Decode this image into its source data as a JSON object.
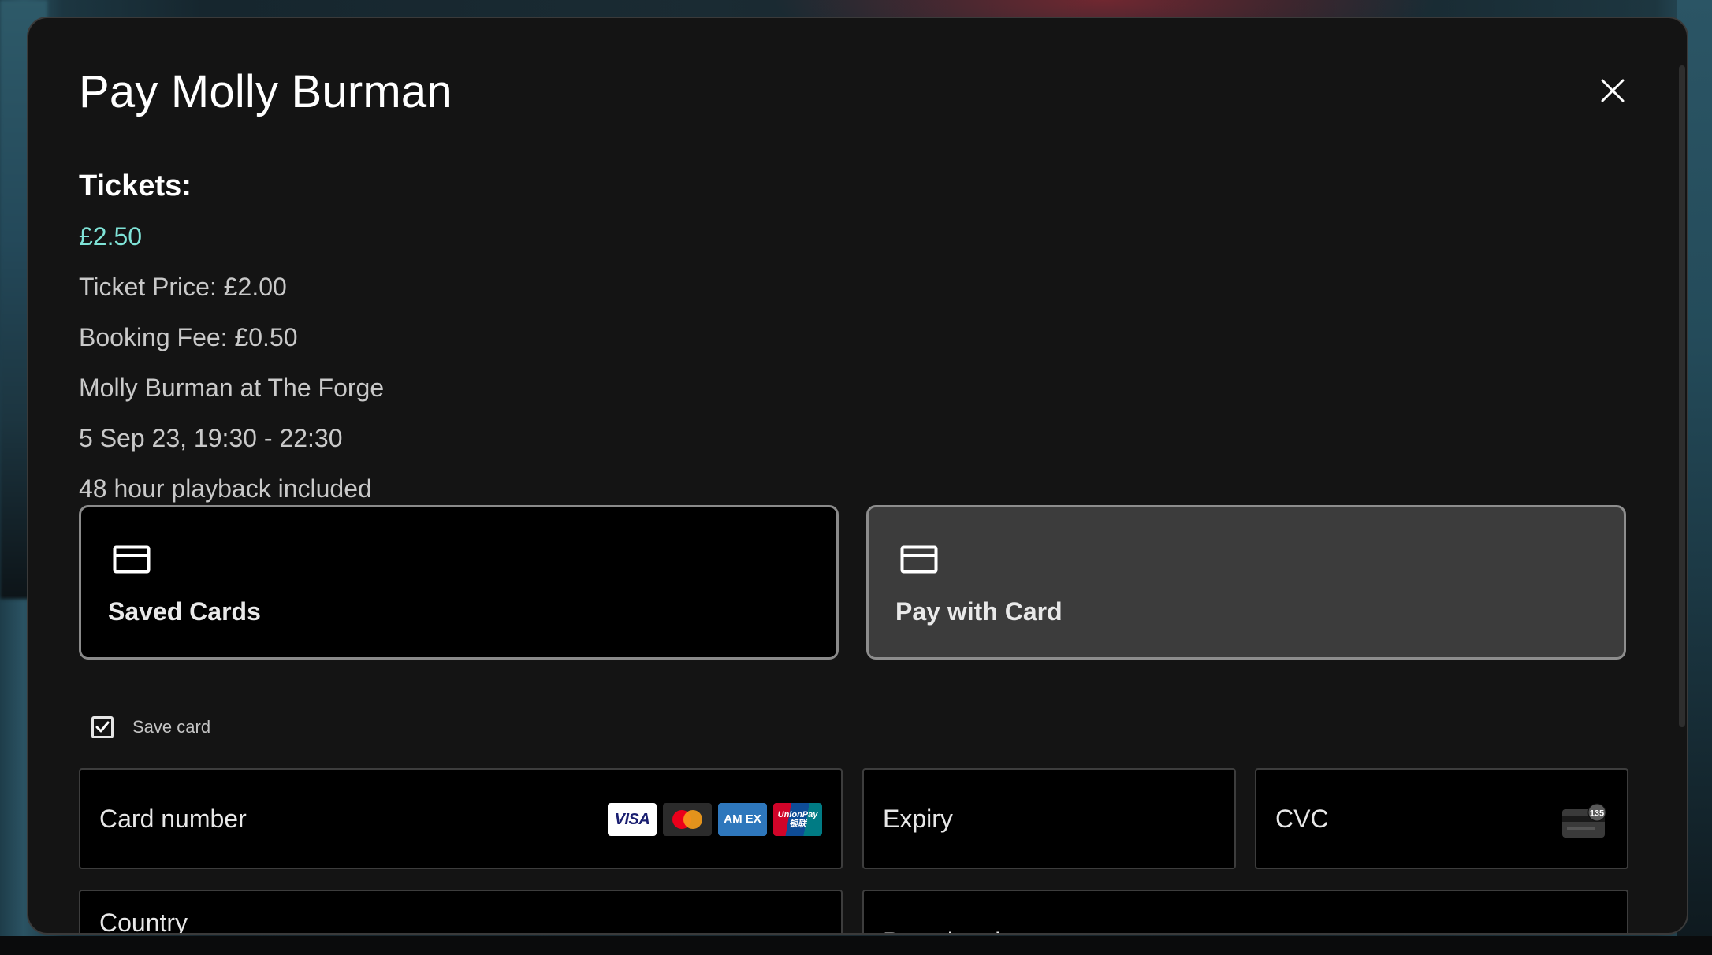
{
  "modal": {
    "title": "Pay Molly Burman",
    "close_icon": "close-icon"
  },
  "tickets": {
    "heading": "Tickets:",
    "total": "£2.50",
    "ticket_price": "Ticket Price: £2.00",
    "booking_fee": "Booking Fee: £0.50",
    "event": "Molly Burman at The Forge",
    "datetime": "5 Sep 23, 19:30 - 22:30",
    "playback": "48 hour playback included"
  },
  "payment_options": [
    {
      "label": "Saved Cards",
      "icon": "credit-card-icon",
      "selected": false
    },
    {
      "label": "Pay with Card",
      "icon": "credit-card-icon",
      "selected": true
    }
  ],
  "save_card": {
    "label": "Save card",
    "checked": true
  },
  "fields": {
    "card_number": "Card number",
    "expiry": "Expiry",
    "cvc": "CVC",
    "country": "Country",
    "postal_code": "Postal code"
  },
  "card_brands": {
    "visa": "VISA",
    "amex": "AM EX",
    "unionpay": "UnionPay 银联",
    "cvc_badge": "135"
  },
  "colors": {
    "accent_price": "#7fe3d7",
    "modal_bg": "#141414",
    "selected_option_bg": "#3c3c3c"
  }
}
